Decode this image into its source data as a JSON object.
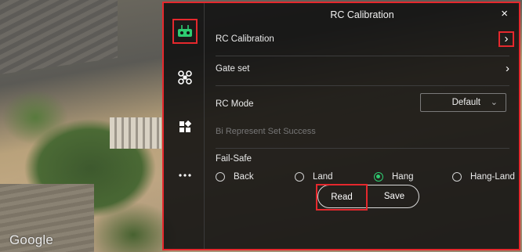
{
  "map": {
    "provider_logo": "Google"
  },
  "sidebar": {
    "items": [
      {
        "icon": "rc-controller-icon",
        "active": true
      },
      {
        "icon": "drone-icon",
        "active": false
      },
      {
        "icon": "grid-apps-icon",
        "active": false
      },
      {
        "icon": "more-dots-icon",
        "active": false
      }
    ]
  },
  "header": {
    "title": "RC Calibration",
    "close_glyph": "×"
  },
  "rows": {
    "rc_calibration": {
      "label": "RC Calibration",
      "chevron": "›"
    },
    "gate_set": {
      "label": "Gate set",
      "chevron": "›"
    },
    "rc_mode": {
      "label": "RC Mode",
      "value": "Default",
      "caret": "⌄"
    },
    "status": "Bi Represent Set Success"
  },
  "fail_safe": {
    "label": "Fail-Safe",
    "options": [
      {
        "label": "Back",
        "selected": false
      },
      {
        "label": "Land",
        "selected": false
      },
      {
        "label": "Hang",
        "selected": true
      },
      {
        "label": "Hang-Land",
        "selected": false
      }
    ]
  },
  "actions": {
    "read_label": "Read",
    "save_label": "Save"
  },
  "colors": {
    "highlight": "#e5282d",
    "selected_radio": "#2ecc71",
    "rc_icon": "#2ecc71"
  }
}
